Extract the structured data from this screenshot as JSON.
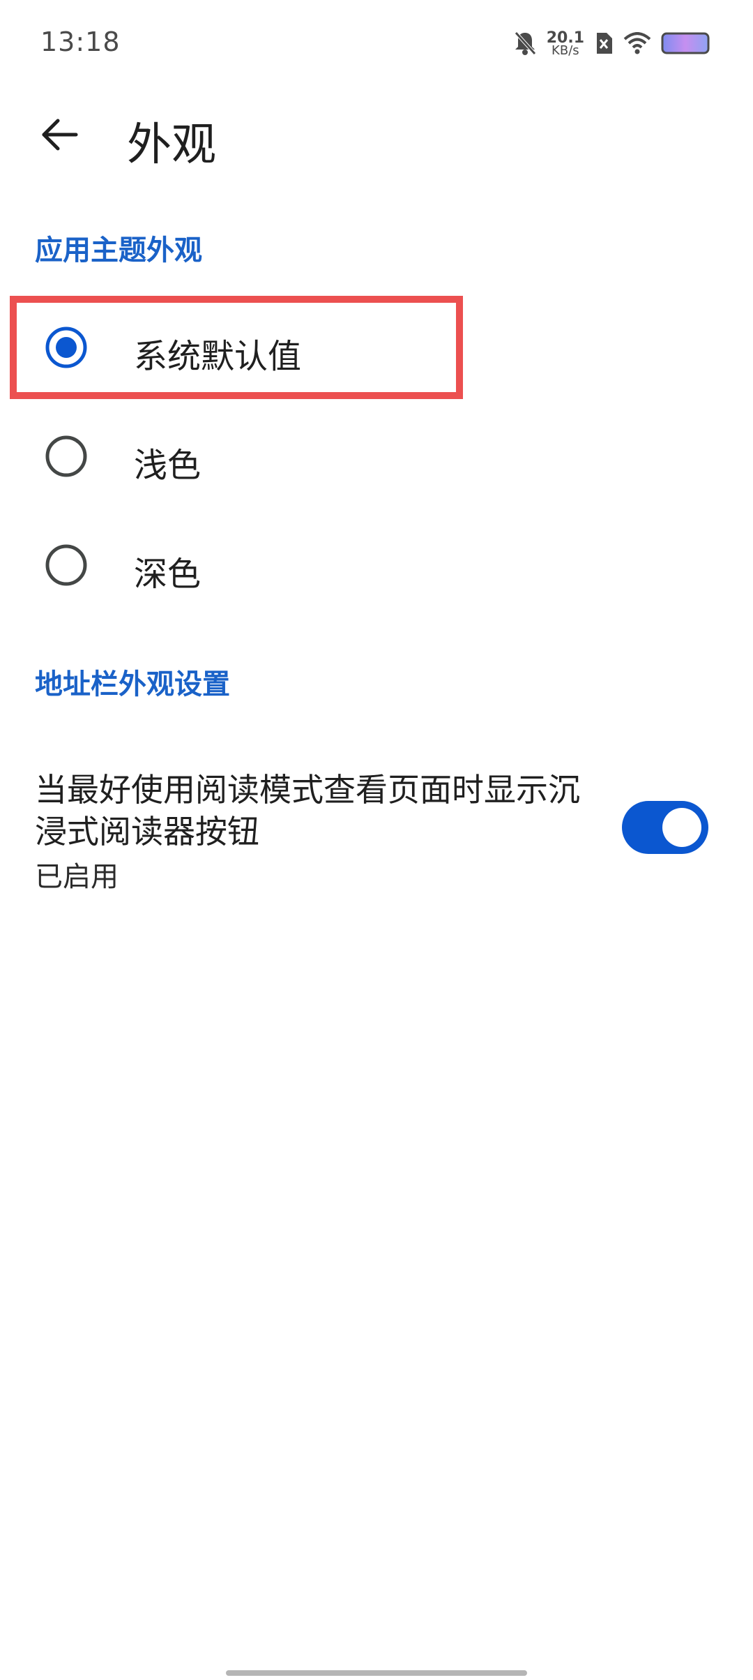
{
  "status_bar": {
    "time": "13:18",
    "net_speed_value": "20.1",
    "net_speed_unit": "KB/s",
    "icons": [
      "bell-off-icon",
      "sim-x-icon",
      "wifi-icon",
      "battery-icon"
    ]
  },
  "app_bar": {
    "back_icon": "arrow-left-icon",
    "title": "外观"
  },
  "theme_section": {
    "header": "应用主题外观",
    "options": [
      {
        "label": "系统默认值",
        "selected": true
      },
      {
        "label": "浅色",
        "selected": false
      },
      {
        "label": "深色",
        "selected": false
      }
    ]
  },
  "address_bar_section": {
    "header": "地址栏外观设置",
    "setting": {
      "title": "当最好使用阅读模式查看页面时显示沉浸式阅读器按钮",
      "summary": "已启用",
      "enabled": true
    }
  },
  "colors": {
    "accent": "#0b57d0",
    "section_header": "#1a62c8",
    "highlight": "#ec5050"
  }
}
